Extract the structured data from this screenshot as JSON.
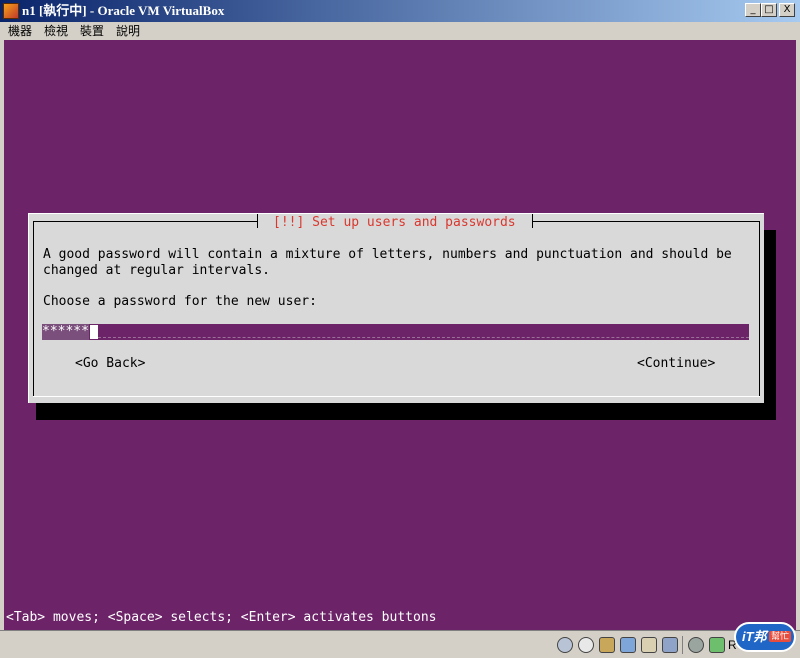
{
  "window": {
    "title": "n1 [執行中] - Oracle VM VirtualBox",
    "controls": {
      "minimize": "_",
      "maximize": "□",
      "close": "X"
    }
  },
  "menu": [
    "機器",
    "檢視",
    "裝置",
    "說明"
  ],
  "dialog": {
    "title": "[!!] Set up users and passwords",
    "description": "A good password will contain a mixture of letters, numbers and punctuation and should be\nchanged at regular intervals.",
    "prompt": "Choose a password for the new user:",
    "password_value": "******",
    "buttons": {
      "back": "<Go Back>",
      "continue": "<Continue>"
    }
  },
  "status_line": "<Tab> moves; <Space> selects; <Enter> activates buttons",
  "statusbar": {
    "icons": [
      "hard-disk-icon",
      "optical-drive-icon",
      "usb-icon",
      "network-icon",
      "shared-folder-icon",
      "display-icon",
      "mouse-integration-icon",
      "arrow-down-icon"
    ],
    "host_key": "R"
  },
  "watermark": {
    "text": "iT邦",
    "badge": "幫忙"
  },
  "colors": {
    "vm_background": "#6c2368",
    "dialog_bg": "#d9d9d9",
    "dialog_title": "#d9382f",
    "titlebar": "#0a246a"
  }
}
